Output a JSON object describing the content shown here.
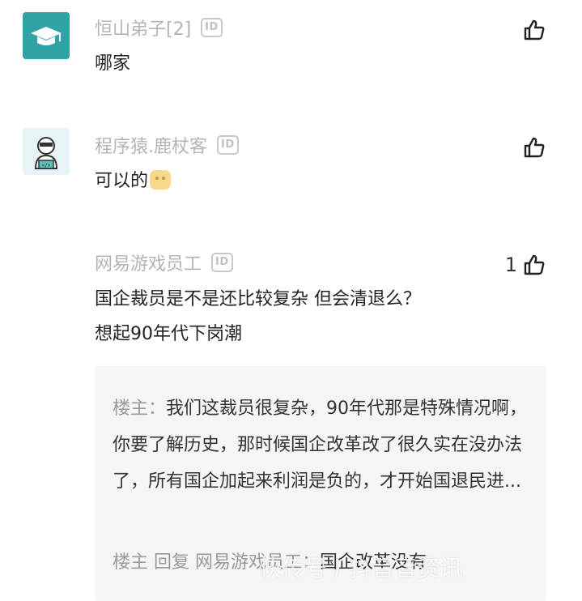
{
  "comments": [
    {
      "username": "恒山弟子[2]",
      "id_badge": "ID",
      "text": "哪家",
      "likes": "",
      "avatar": "graduation-cap-icon"
    },
    {
      "username": "程序猿.鹿杖客",
      "id_badge": "ID",
      "text": "可以的",
      "likes": "",
      "avatar": "programmer-icon"
    },
    {
      "username": "网易游戏员工",
      "id_badge": "ID",
      "text_line1": "国企裁员是不是还比较复杂 但会清退么？",
      "text_line2": "想起90年代下岗潮",
      "likes": "1"
    }
  ],
  "reply": {
    "author": "楼主：",
    "text": "我们这裁员很复杂，90年代那是特殊情况啊，你要了解历史，那时候国企改革改了很久实在没办法了，所有国企加起来利润是负的，才开始国退民进...",
    "line2_author": "楼主 回复 网易游戏员工：",
    "line2_text": "国企改革没有"
  },
  "watermark": "快传号 / 抖音音资讯"
}
